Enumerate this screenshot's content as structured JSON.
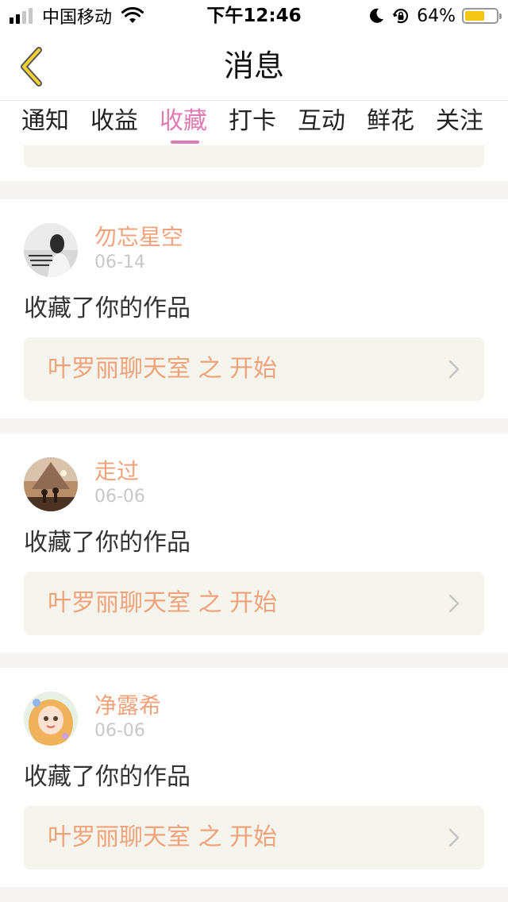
{
  "status_bar": {
    "carrier": "中国移动",
    "time": "下午12:46",
    "battery_percent": "64%",
    "battery_level": 0.64,
    "signal_bars": 2,
    "icons": [
      "signal-icon",
      "wifi-icon",
      "moon-icon",
      "rotation-lock-icon",
      "battery-icon"
    ]
  },
  "nav": {
    "title": "消息",
    "back_icon": "chevron-left-icon"
  },
  "tabs": [
    {
      "label": "通知"
    },
    {
      "label": "收益"
    },
    {
      "label": "收藏",
      "active": true
    },
    {
      "label": "打卡"
    },
    {
      "label": "互动"
    },
    {
      "label": "鲜花"
    },
    {
      "label": "关注"
    }
  ],
  "messages": [
    {
      "username": "勿忘星空",
      "date": "06-14",
      "action": "收藏了你的作品",
      "work": "叶罗丽聊天室 之 开始"
    },
    {
      "username": "走过",
      "date": "06-06",
      "action": "收藏了你的作品",
      "work": "叶罗丽聊天室 之 开始"
    },
    {
      "username": "净露希",
      "date": "06-06",
      "action": "收藏了你的作品",
      "work": "叶罗丽聊天室 之 开始"
    }
  ],
  "colors": {
    "accent_pink": "#e07bb1",
    "name_orange": "#f0a37b",
    "link_background": "#f5f4ed",
    "page_background": "#f7f4f4",
    "battery_yellow": "#f5c518"
  }
}
